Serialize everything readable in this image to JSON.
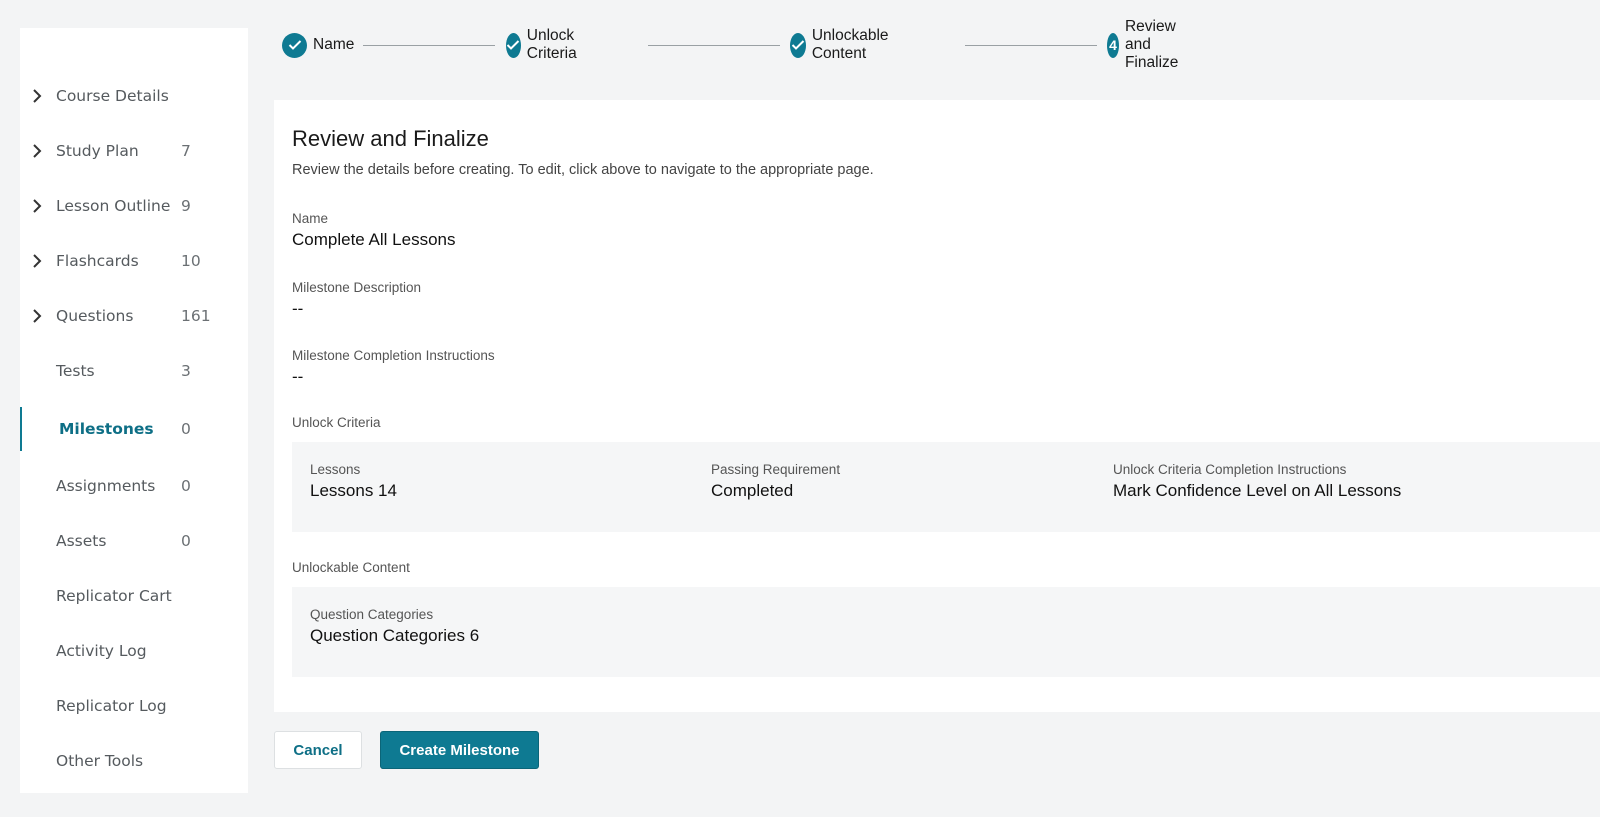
{
  "sidebar": {
    "items": [
      {
        "label": "Course Details",
        "count": "",
        "chevron": true,
        "active": false
      },
      {
        "label": "Study Plan",
        "count": "7",
        "chevron": true,
        "active": false
      },
      {
        "label": "Lesson Outline",
        "count": "9",
        "chevron": true,
        "active": false
      },
      {
        "label": "Flashcards",
        "count": "10",
        "chevron": true,
        "active": false
      },
      {
        "label": "Questions",
        "count": "161",
        "chevron": true,
        "active": false
      },
      {
        "label": "Tests",
        "count": "3",
        "chevron": false,
        "active": false
      },
      {
        "label": "Milestones",
        "count": "0",
        "chevron": false,
        "active": true
      },
      {
        "label": "Assignments",
        "count": "0",
        "chevron": false,
        "active": false
      },
      {
        "label": "Assets",
        "count": "0",
        "chevron": false,
        "active": false
      },
      {
        "label": "Replicator Cart",
        "count": "",
        "chevron": false,
        "active": false
      },
      {
        "label": "Activity Log",
        "count": "",
        "chevron": false,
        "active": false
      },
      {
        "label": "Replicator Log",
        "count": "",
        "chevron": false,
        "active": false
      },
      {
        "label": "Other Tools",
        "count": "",
        "chevron": false,
        "active": false
      }
    ]
  },
  "stepper": {
    "steps": [
      {
        "label": "Name",
        "status": "complete",
        "number": ""
      },
      {
        "label": "Unlock Criteria",
        "status": "complete",
        "number": ""
      },
      {
        "label": "Unlockable Content",
        "status": "complete",
        "number": ""
      },
      {
        "label": "Review and Finalize",
        "status": "current",
        "number": "4"
      }
    ]
  },
  "review": {
    "title": "Review and Finalize",
    "subtitle": "Review the details before creating. To edit, click above to navigate to the appropriate page.",
    "name_label": "Name",
    "name_value": "Complete All Lessons",
    "description_label": "Milestone Description",
    "description_value": "--",
    "instructions_label": "Milestone Completion Instructions",
    "instructions_value": "--",
    "unlock_criteria": {
      "heading": "Unlock Criteria",
      "lessons_label": "Lessons",
      "lessons_value": "Lessons 14",
      "passing_label": "Passing Requirement",
      "passing_value": "Completed",
      "completion_label": "Unlock Criteria Completion Instructions",
      "completion_value": "Mark Confidence Level on All Lessons"
    },
    "unlockable_content": {
      "heading": "Unlockable Content",
      "categories_label": "Question Categories",
      "categories_value": "Question Categories 6"
    }
  },
  "actions": {
    "cancel_label": "Cancel",
    "create_label": "Create Milestone"
  },
  "colors": {
    "accent": "#0e7a92",
    "background": "#f3f4f5",
    "panel": "#ffffff",
    "box": "#f5f6f7"
  }
}
